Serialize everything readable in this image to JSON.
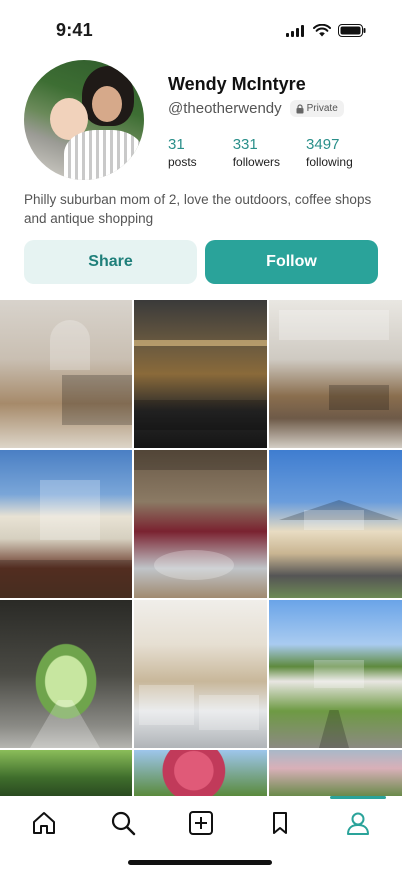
{
  "status_bar": {
    "time": "9:41"
  },
  "profile": {
    "name": "Wendy McIntyre",
    "handle": "@theotherwendy",
    "privacy_label": "Private",
    "stats": [
      {
        "value": "31",
        "label": "posts"
      },
      {
        "value": "331",
        "label": "followers"
      },
      {
        "value": "3497",
        "label": "following"
      }
    ],
    "bio": "Philly suburban mom of 2, love the outdoors, coffee shops and antique shopping"
  },
  "actions": {
    "share_label": "Share",
    "follow_label": "Follow"
  },
  "grid": {
    "tiles": [
      {
        "icon": "photo-kitchen-interior"
      },
      {
        "icon": "photo-bar-interior"
      },
      {
        "icon": "photo-restaurant-interior"
      },
      {
        "icon": "photo-hotel-building"
      },
      {
        "icon": "photo-wine-shop"
      },
      {
        "icon": "photo-winery-building"
      },
      {
        "icon": "photo-tunnel-trail"
      },
      {
        "icon": "photo-jewelry-shop"
      },
      {
        "icon": "photo-mansion-park"
      },
      {
        "icon": "photo-trees"
      },
      {
        "icon": "photo-flowers"
      },
      {
        "icon": "photo-blossom-tree"
      }
    ]
  },
  "tabbar": {
    "items": [
      {
        "icon": "home-icon"
      },
      {
        "icon": "search-icon"
      },
      {
        "icon": "add-post-icon"
      },
      {
        "icon": "bookmark-icon"
      },
      {
        "icon": "profile-icon",
        "active": true
      }
    ],
    "accent_color": "#2aa39a"
  },
  "colors": {
    "accent": "#2aa39a",
    "accent_light": "#e6f3f2",
    "stat_color": "#2a8f8a"
  }
}
